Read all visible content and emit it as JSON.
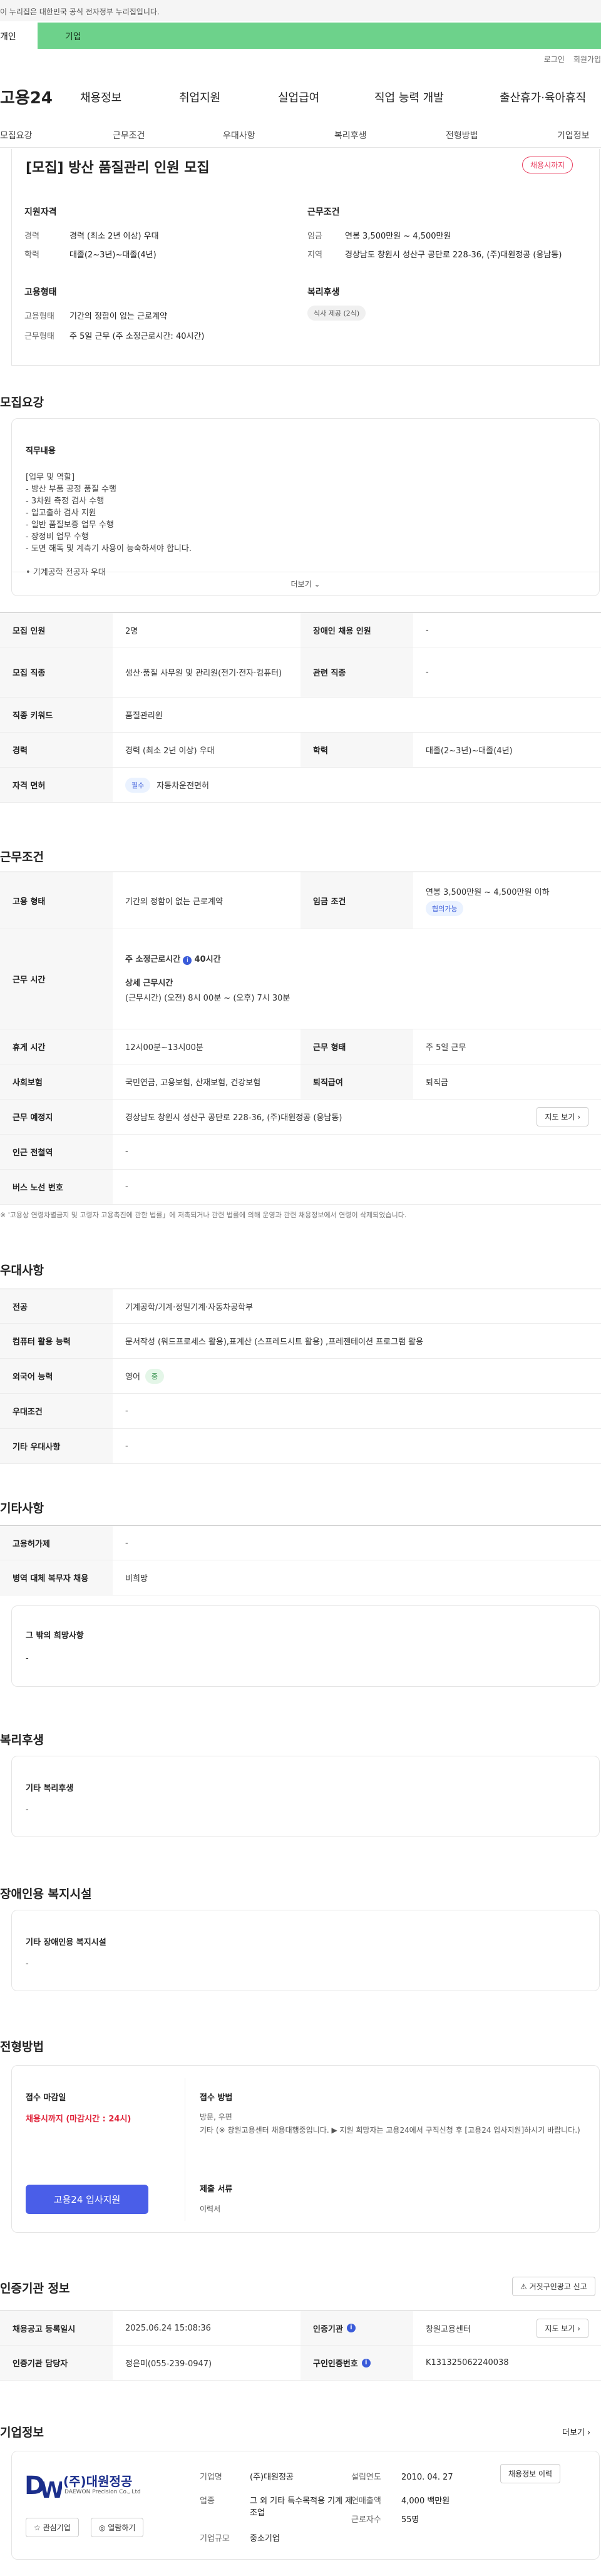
{
  "gov_banner": "이 누리집은 대한민국 공식 전자정부 누리집입니다.",
  "tabs": [
    "개인",
    "기업"
  ],
  "util": [
    "로그인",
    "회원가입"
  ],
  "gnb": {
    "logo": "고용24",
    "menu": [
      "채용정보",
      "취업지원",
      "실업급여",
      "직업 능력 개발",
      "출산휴가·육아휴직"
    ]
  },
  "snb": [
    "모집요강",
    "근무조건",
    "우대사항",
    "복리후생",
    "전형방법",
    "기업정보"
  ],
  "header": {
    "title": "[모집] 방산 품질관리 인원 모집",
    "badge": "채용시까지",
    "qual_title": "지원자격",
    "cond_title": "근무조건",
    "emp_title": "고용형태",
    "welfare_title": "복리후생",
    "qual": [
      {
        "k": "경력",
        "v": "경력 (최소 2년 이상) 우대"
      },
      {
        "k": "학력",
        "v": "대졸(2~3년)~대졸(4년)"
      }
    ],
    "cond": [
      {
        "k": "임금",
        "v": "연봉 3,500만원 ~ 4,500만원"
      },
      {
        "k": "지역",
        "v": "경상남도 창원시 성산구 공단로 228-36, (주)대원정공 (웅남동)"
      }
    ],
    "emp": [
      {
        "k": "고용형태",
        "v": "기간의 정함이 없는 근로계약"
      },
      {
        "k": "근무형태",
        "v": "주 5일 근무 (주 소정근로시간: 40시간)"
      }
    ],
    "welfare_chip": "식사 제공 (2식)"
  },
  "recruit": {
    "title": "모집요강",
    "job_label": "직무내용",
    "job_lines": [
      "[업무 및 역할]",
      "- 방산 부품 공정 품질 수행",
      "- 3차원 측정 검사 수행",
      "- 입고출하 검사 지원",
      "- 일반 품질보증 업무 수행",
      "- 장정비 업무 수행",
      "- 도면 해독 및 계측기 사용이 능숙하셔야 합니다.",
      "",
      "• 기계공학 전공자 우대"
    ],
    "more": "더보기",
    "rows": [
      [
        "모집 인원",
        "2명",
        "장애인 채용 인원",
        "-"
      ],
      [
        "모집 직종",
        "생산·품질 사무원 및 관리원(전기·전자·컴퓨터)",
        "관련 직종",
        "-"
      ],
      [
        "직종 키워드",
        "품질관리원",
        "",
        ""
      ],
      [
        "경력",
        "경력 (최소 2년 이상) 우대",
        "학력",
        "대졸(2~3년)~대졸(4년)"
      ],
      [
        "자격 면허",
        "자동차운전면허",
        "",
        ""
      ]
    ],
    "license_chip": "필수"
  },
  "work": {
    "title": "근무조건",
    "emp_type_k": "고용 형태",
    "emp_type_v": "기간의 정함이 없는 근로계약",
    "wage_k": "임금 조건",
    "wage_v": "연봉 3,500만원 ~ 4,500만원 이하",
    "wage_chip": "협의가능",
    "time_k": "근무 시간",
    "time_main": "주 소정근로시간",
    "time_hours": "40시간",
    "time_detail_title": "상세 근무시간",
    "time_detail": "(근무시간) (오전) 8시 00분 ~ (오후) 7시 30분",
    "rest_k": "휴게 시간",
    "rest_v": "12시00분~13시00분",
    "form_k": "근무 형태",
    "form_v": "주 5일 근무",
    "ins_k": "사회보험",
    "ins_v": "국민연금, 고용보험, 산재보험, 건강보험",
    "ret_k": "퇴직급여",
    "ret_v": "퇴직금",
    "place_k": "근무 예정지",
    "place_v": "경상남도 창원시 성산구 공단로 228-36, (주)대원정공 (웅남동)",
    "map_btn": "지도 보기",
    "subway_k": "인근 전철역",
    "subway_v": "-",
    "bus_k": "버스 노선 번호",
    "bus_v": "-",
    "note": "※ '고용상 연령차별금지 및 고령자 고용촉진에 관한 법률」에 저촉되거나 관련 법률에 의해 운영과 관련 채용정보에서 연령이 삭제되었습니다."
  },
  "pref": {
    "title": "우대사항",
    "rows": [
      [
        "전공",
        "기계공학/기계·정밀기계·자동차공학부"
      ],
      [
        "컴퓨터 활용 능력",
        "문서작성 (워드프로세스 활용),표계산 (스프레드시트 활용) ,프레젠테이션 프로그램 활용"
      ],
      [
        "외국어 능력",
        "영어"
      ],
      [
        "우대조건",
        "-"
      ],
      [
        "기타 우대사항",
        "-"
      ]
    ],
    "lang_chip": "중"
  },
  "etc": {
    "title": "기타사항",
    "rows": [
      [
        "고용허가제",
        "-"
      ],
      [
        "병역 대체 복무자 채용",
        "비희망"
      ]
    ],
    "other_title": "그 밖의 희망사항",
    "other_v": "-"
  },
  "welfare": {
    "title": "복리후생",
    "label": "기타 복리후생",
    "value": "-"
  },
  "disabled": {
    "title": "장애인용 복지시설",
    "label": "기타 장애인용 복지시설",
    "value": "-"
  },
  "process": {
    "title": "전형방법",
    "deadline_label": "접수 마감일",
    "deadline": "채용시까지 (마감시간 : 24시)",
    "apply_btn": "고용24 입사지원",
    "method_title": "접수 방법",
    "method_lines": [
      "방문, 우편",
      "기타 (※ 창원고용센터 채용대행중입니다. ▶ 지원 희망자는 고용24에서 구직신청 후 [고용24 입사지원]하시기 바랍니다.)"
    ],
    "docs_title": "제출 서류",
    "docs_v": "이력서"
  },
  "cert": {
    "title": "인증기관 정보",
    "btn": "거짓구인광고 신고",
    "rows": [
      [
        "채용공고 등록일시",
        "2025.06.24 15:08:36",
        "인증기관",
        "창원고용센터"
      ],
      [
        "인증기관 담당자",
        "정은미(055-239-0947)",
        "구인인증번호",
        "K131325062240038"
      ]
    ],
    "map_btn": "지도 보기"
  },
  "company": {
    "title": "기업정보",
    "more": "더보기",
    "logo_text": "(주)대원정공",
    "logo_sub": "DAEWON Precision Co., Ltd",
    "fav": "관심기업",
    "follow": "열람하기",
    "items": [
      [
        "기업명",
        "(주)대원정공",
        "설립연도",
        "2010. 04. 27"
      ],
      [
        "업종",
        "그 외 기타 특수목적용 기계 제조업",
        "연매출액",
        "4,000 백만원"
      ],
      [
        "기업규모",
        "중소기업",
        "근로자수",
        "55명"
      ]
    ],
    "jobs_btn": "채용정보 이력"
  }
}
